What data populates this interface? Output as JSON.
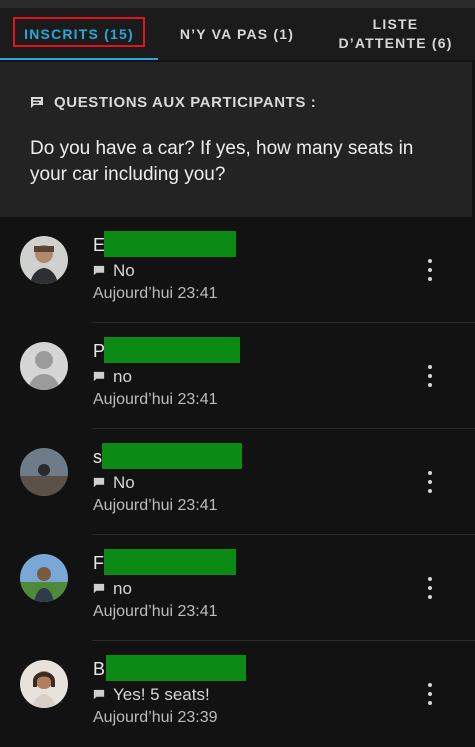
{
  "tabs": [
    {
      "label": "INSCRITS (15)",
      "active": true
    },
    {
      "label": "N’Y VA PAS (1)",
      "active": false
    },
    {
      "label_line1": "LISTE",
      "label_line2": "D’ATTENTE (6)",
      "active": false
    }
  ],
  "questions": {
    "title": "QUESTIONS AUX PARTICIPANTS :",
    "text": "Do you have a car? If yes, how many seats in your car including you?"
  },
  "attendees": [
    {
      "initial": "E",
      "answer": "No",
      "time": "Aujourd’hui 23:41"
    },
    {
      "initial": "P",
      "answer": "no",
      "time": "Aujourd’hui 23:41"
    },
    {
      "initial": "s",
      "answer": "No",
      "time": "Aujourd’hui 23:41"
    },
    {
      "initial": "F",
      "answer": "no",
      "time": "Aujourd’hui 23:41"
    },
    {
      "initial": "B",
      "answer": "Yes! 5 seats!",
      "time": "Aujourd’hui 23:39"
    }
  ],
  "colors": {
    "accent": "#2aa7d6",
    "highlight": "#e0141b",
    "redaction": "#0b8a14"
  },
  "icons": {
    "comment": "comment-icon",
    "more": "more-vertical-icon"
  }
}
